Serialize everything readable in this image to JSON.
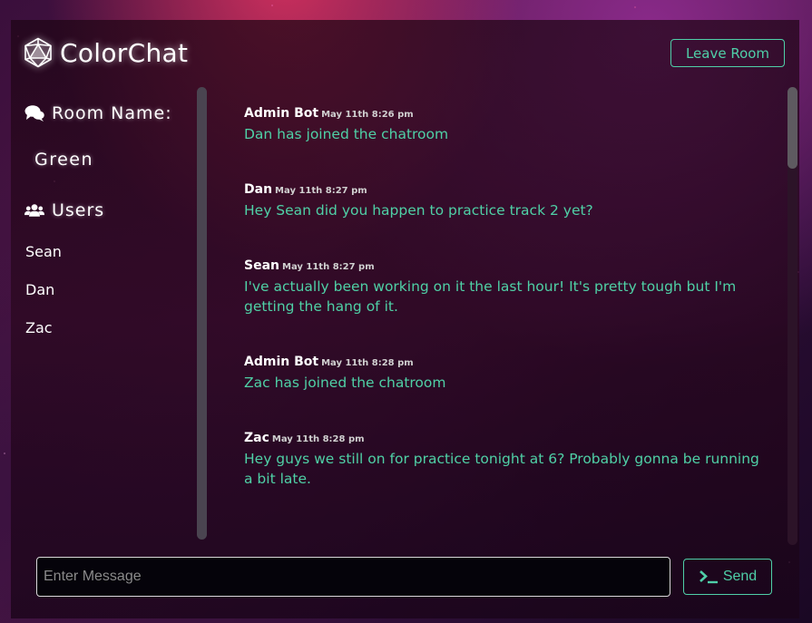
{
  "app": {
    "title": "ColorChat"
  },
  "header": {
    "leave_label": "Leave Room"
  },
  "sidebar": {
    "room_heading": "Room Name:",
    "room_name": "Green",
    "users_heading": "Users",
    "users": [
      "Sean",
      "Dan",
      "Zac"
    ]
  },
  "messages": [
    {
      "author": "Admin Bot",
      "time": "May 11th 8:26 pm",
      "text": "Dan has joined the chatroom"
    },
    {
      "author": "Dan",
      "time": "May 11th 8:27 pm",
      "text": "Hey Sean did you happen to practice track 2 yet?"
    },
    {
      "author": "Sean",
      "time": "May 11th 8:27 pm",
      "text": "I've actually been working on it the last hour! It's pretty tough but I'm getting the hang of it."
    },
    {
      "author": "Admin Bot",
      "time": "May 11th 8:28 pm",
      "text": "Zac has joined the chatroom"
    },
    {
      "author": "Zac",
      "time": "May 11th 8:28 pm",
      "text": "Hey guys we still on for practice tonight at 6? Probably gonna be running a bit late."
    }
  ],
  "composer": {
    "placeholder": "Enter Message",
    "value": "",
    "send_label": "Send"
  },
  "icons": {
    "logo": "d20-dice-icon",
    "room": "comments-icon",
    "users": "users-icon",
    "send": "terminal-prompt-icon"
  },
  "colors": {
    "accent": "#4fcfa8",
    "message_text": "#4fd0a6"
  }
}
